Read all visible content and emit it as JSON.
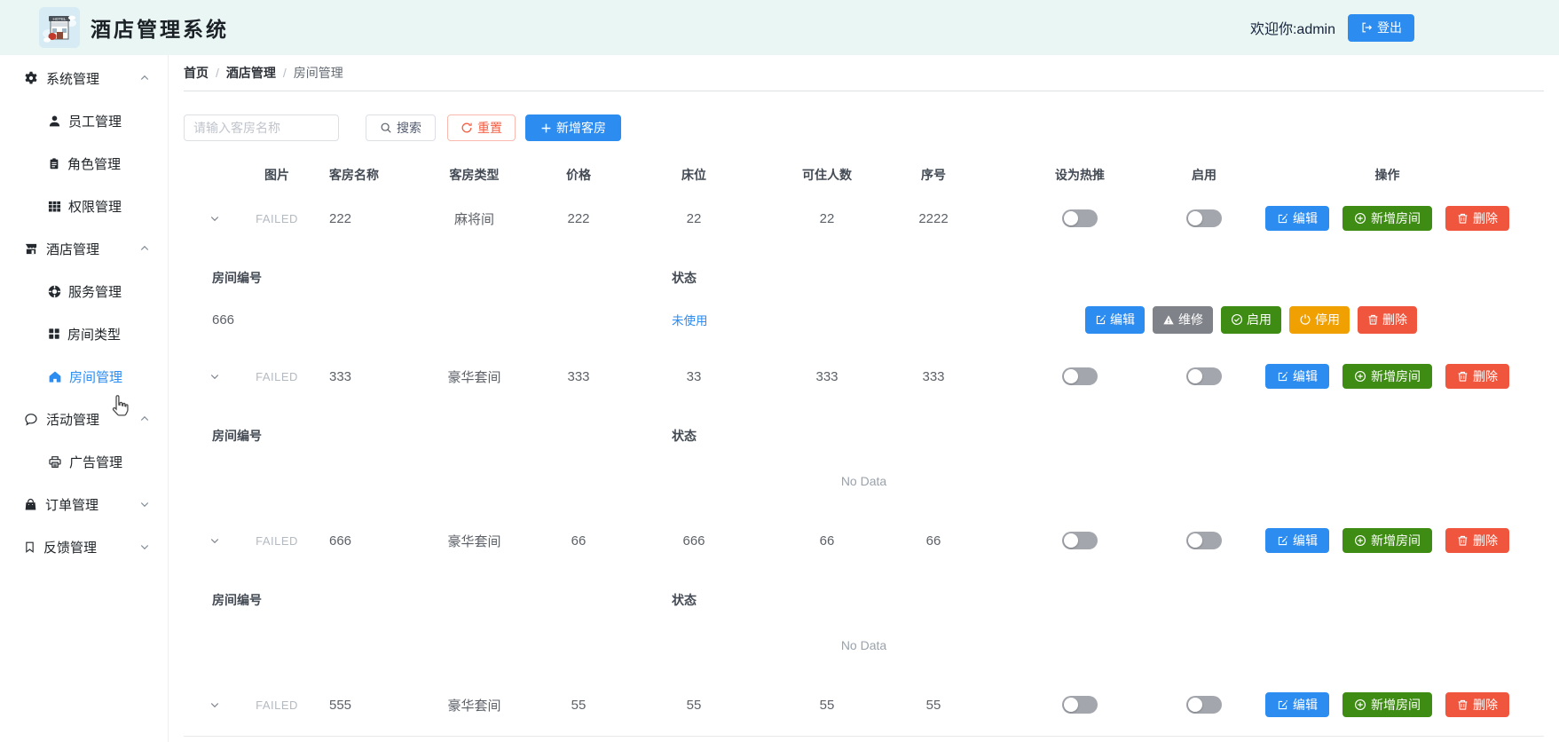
{
  "header": {
    "title": "酒店管理系统",
    "welcome": "欢迎你:admin",
    "logout_label": "登出"
  },
  "sidebar": {
    "groups": [
      {
        "id": "system",
        "label": "系统管理",
        "icon": "gear-icon",
        "expanded": true,
        "children": [
          {
            "id": "staff",
            "label": "员工管理",
            "icon": "user-icon",
            "active": false
          },
          {
            "id": "role",
            "label": "角色管理",
            "icon": "role-badge-icon",
            "active": false
          },
          {
            "id": "permission",
            "label": "权限管理",
            "icon": "grid-icon",
            "active": false
          }
        ]
      },
      {
        "id": "hotel",
        "label": "酒店管理",
        "icon": "shop-icon",
        "expanded": true,
        "children": [
          {
            "id": "service",
            "label": "服务管理",
            "icon": "lifebuoy-icon",
            "active": false
          },
          {
            "id": "room-type",
            "label": "房间类型",
            "icon": "squares-icon",
            "active": false
          },
          {
            "id": "room",
            "label": "房间管理",
            "icon": "house-icon",
            "active": true
          }
        ]
      },
      {
        "id": "activity",
        "label": "活动管理",
        "icon": "chat-icon",
        "expanded": true,
        "children": [
          {
            "id": "ad",
            "label": "广告管理",
            "icon": "ad-board-icon",
            "active": false
          }
        ]
      },
      {
        "id": "order",
        "label": "订单管理",
        "icon": "bag-icon",
        "expanded": false,
        "children": []
      },
      {
        "id": "feedback",
        "label": "反馈管理",
        "icon": "bookmark-icon",
        "expanded": false,
        "children": []
      }
    ]
  },
  "breadcrumb": {
    "items": [
      "首页",
      "酒店管理",
      "房间管理"
    ],
    "separator": "/"
  },
  "toolbar": {
    "search_placeholder": "请输入客房名称",
    "search_label": "搜索",
    "reset_label": "重置",
    "add_label": "新增客房"
  },
  "table": {
    "columns": [
      "图片",
      "客房名称",
      "客房类型",
      "价格",
      "床位",
      "可住人数",
      "序号",
      "设为热推",
      "启用",
      "操作"
    ],
    "image_failed_text": "FAILED",
    "row_actions": {
      "edit": "编辑",
      "add_room": "新增房间",
      "delete": "删除"
    },
    "sub_columns": [
      "房间编号",
      "状态"
    ],
    "sub_actions": {
      "edit": "编辑",
      "repair": "维修",
      "enable": "启用",
      "disable": "停用",
      "delete": "删除"
    },
    "no_data_text": "No Data",
    "rows": [
      {
        "name": "222",
        "type": "麻将间",
        "price": "222",
        "beds": "22",
        "capacity": "22",
        "seq": "2222",
        "hot": false,
        "enabled": false,
        "expanded": true,
        "sub_rows": [
          {
            "room_no": "666",
            "status": "未使用"
          }
        ]
      },
      {
        "name": "333",
        "type": "豪华套间",
        "price": "333",
        "beds": "33",
        "capacity": "333",
        "seq": "333",
        "hot": false,
        "enabled": false,
        "expanded": true,
        "sub_rows": []
      },
      {
        "name": "666",
        "type": "豪华套间",
        "price": "66",
        "beds": "666",
        "capacity": "66",
        "seq": "66",
        "hot": false,
        "enabled": false,
        "expanded": true,
        "sub_rows": []
      },
      {
        "name": "555",
        "type": "豪华套间",
        "price": "55",
        "beds": "55",
        "capacity": "55",
        "seq": "55",
        "hot": false,
        "enabled": false,
        "expanded": false,
        "sub_rows": []
      }
    ]
  },
  "theme": {
    "header_bg": "#e9f6f3",
    "primary_blue": "#2d8cf0",
    "green": "#3e8c13",
    "orange": "#f0a000",
    "red": "#f0563e",
    "gray_button": "#7f8289",
    "toggle_off": "#a3a7ad",
    "status_text_blue": "#2d8cf0"
  }
}
